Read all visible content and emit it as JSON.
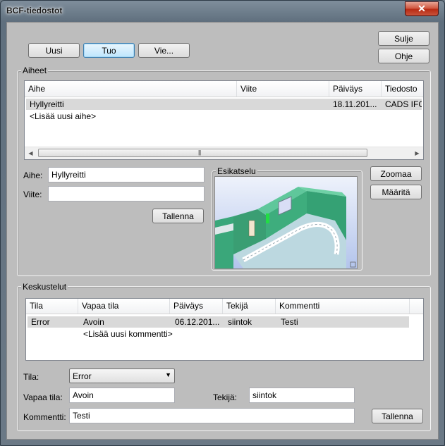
{
  "window": {
    "title": "BCF-tiedostot",
    "close_label": "✕"
  },
  "toolbar": {
    "new_label": "Uusi",
    "import_label": "Tuo",
    "export_label": "Vie..."
  },
  "side_buttons": {
    "close_label": "Sulje",
    "help_label": "Ohje"
  },
  "topics": {
    "group_label": "Aiheet",
    "columns": [
      "Aihe",
      "Viite",
      "Päiväys",
      "Tiedosto"
    ],
    "rows": [
      {
        "aihe": "Hyllyreitti",
        "viite": "",
        "paivays": "18.11.201...",
        "tiedosto": "CADS IFC.i"
      }
    ],
    "add_new": "<Lisää uusi aihe>",
    "subject_label": "Aihe:",
    "subject_value": "Hyllyreitti",
    "reference_label": "Viite:",
    "reference_value": "",
    "save_label": "Tallenna",
    "preview_label": "Esikatselu",
    "zoom_label": "Zoomaa",
    "define_label": "Määritä"
  },
  "discussions": {
    "group_label": "Keskustelut",
    "columns": [
      "Tila",
      "Vapaa tila",
      "Päiväys",
      "Tekijä",
      "Kommentti"
    ],
    "rows": [
      {
        "tila": "Error",
        "vapaa_tila": "Avoin",
        "paivays": "06.12.201...",
        "tekija": "siintok",
        "kommentti": "Testi"
      }
    ],
    "add_new": "<Lisää uusi kommentti>",
    "status_label": "Tila:",
    "status_value": "Error",
    "free_status_label": "Vapaa tila:",
    "free_status_value": "Avoin",
    "author_label": "Tekijä:",
    "author_value": "siintok",
    "comment_label": "Kommentti:",
    "comment_value": "Testi",
    "save_label": "Tallenna"
  }
}
